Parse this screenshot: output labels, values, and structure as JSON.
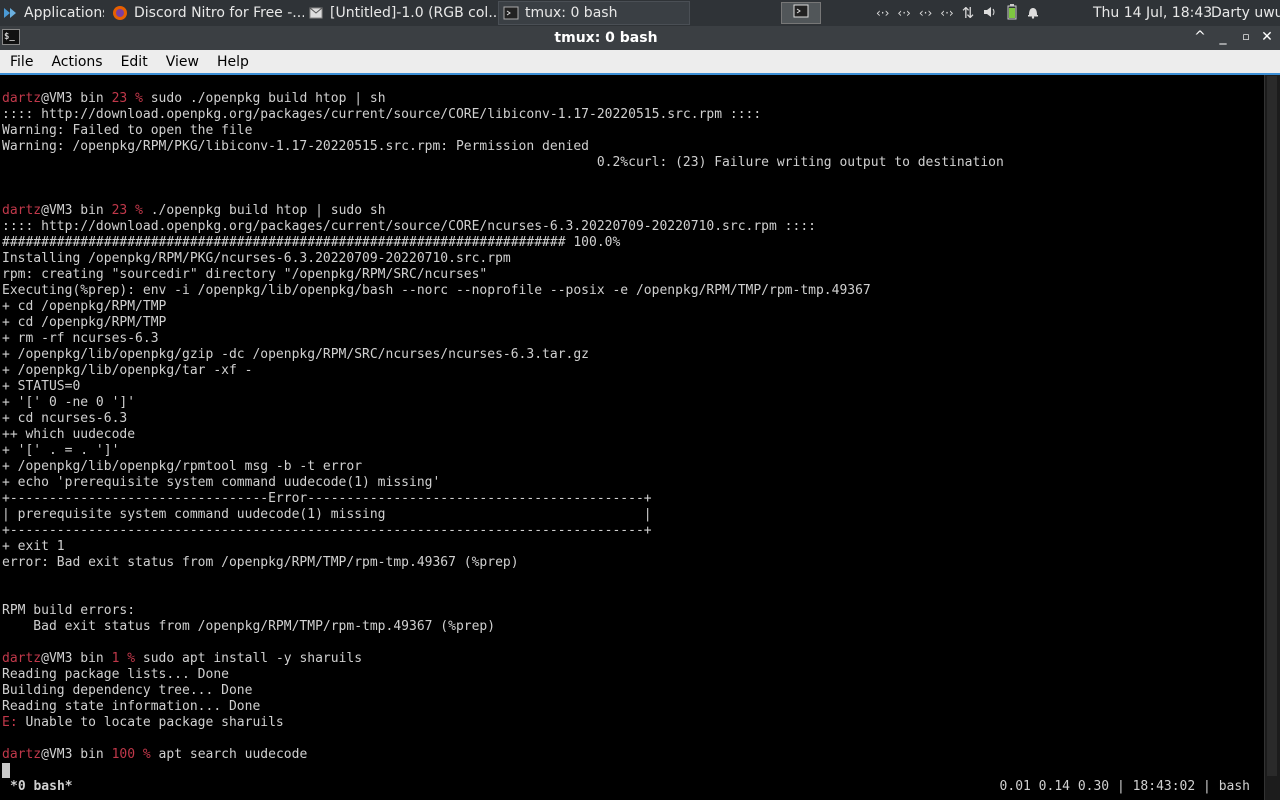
{
  "panel": {
    "applications": "Applications",
    "tasks": [
      {
        "label": "Discord Nitro for Free -...",
        "icon": "firefox-icon"
      },
      {
        "label": "[Untitled]-1.0 (RGB col...",
        "icon": "gimp-icon"
      },
      {
        "label": "tmux: 0 bash",
        "icon": "terminal-icon"
      }
    ],
    "tray_icons": [
      "network-icon",
      "network-icon",
      "network-icon",
      "network-icon",
      "transfer-icon",
      "volume-icon",
      "battery-icon",
      "bell-icon"
    ],
    "tray_glyphs": [
      "‹·›",
      "‹·›",
      "‹·›",
      "‹·›",
      "⇅",
      "🔊",
      "▮",
      "🔔"
    ],
    "clock": "Thu 14 Jul, 18:43",
    "user": "Darty uwu"
  },
  "window": {
    "title": "tmux: 0 bash",
    "menu": [
      "File",
      "Actions",
      "Edit",
      "View",
      "Help"
    ]
  },
  "prompt": {
    "user": "dartz",
    "host_dir": "@VM3 bin "
  },
  "terminal": [
    {
      "type": "prompt",
      "code": "23",
      "cmd": " sudo ./openpkg build htop | sh"
    },
    {
      "type": "text",
      "text": ":::: http://download.openpkg.org/packages/current/source/CORE/libiconv-1.17-20220515.src.rpm ::::"
    },
    {
      "type": "text",
      "text": "Warning: Failed to open the file"
    },
    {
      "type": "text",
      "text": "Warning: /openpkg/RPM/PKG/libiconv-1.17-20220515.src.rpm: Permission denied"
    },
    {
      "type": "text",
      "text": "                                                                            0.2%curl: (23) Failure writing output to destination"
    },
    {
      "type": "blank"
    },
    {
      "type": "blank"
    },
    {
      "type": "prompt",
      "code": "23",
      "cmd": " ./openpkg build htop | sudo sh"
    },
    {
      "type": "text",
      "text": ":::: http://download.openpkg.org/packages/current/source/CORE/ncurses-6.3.20220709-20220710.src.rpm ::::"
    },
    {
      "type": "text",
      "text": "######################################################################## 100.0%"
    },
    {
      "type": "text",
      "text": "Installing /openpkg/RPM/PKG/ncurses-6.3.20220709-20220710.src.rpm"
    },
    {
      "type": "text",
      "text": "rpm: creating \"sourcedir\" directory \"/openpkg/RPM/SRC/ncurses\""
    },
    {
      "type": "text",
      "text": "Executing(%prep): env -i /openpkg/lib/openpkg/bash --norc --noprofile --posix -e /openpkg/RPM/TMP/rpm-tmp.49367"
    },
    {
      "type": "text",
      "text": "+ cd /openpkg/RPM/TMP"
    },
    {
      "type": "text",
      "text": "+ cd /openpkg/RPM/TMP"
    },
    {
      "type": "text",
      "text": "+ rm -rf ncurses-6.3"
    },
    {
      "type": "text",
      "text": "+ /openpkg/lib/openpkg/gzip -dc /openpkg/RPM/SRC/ncurses/ncurses-6.3.tar.gz"
    },
    {
      "type": "text",
      "text": "+ /openpkg/lib/openpkg/tar -xf -"
    },
    {
      "type": "text",
      "text": "+ STATUS=0"
    },
    {
      "type": "text",
      "text": "+ '[' 0 -ne 0 ']'"
    },
    {
      "type": "text",
      "text": "+ cd ncurses-6.3"
    },
    {
      "type": "text",
      "text": "++ which uudecode"
    },
    {
      "type": "text",
      "text": "+ '[' . = . ']'"
    },
    {
      "type": "text",
      "text": "+ /openpkg/lib/openpkg/rpmtool msg -b -t error"
    },
    {
      "type": "text",
      "text": "+ echo 'prerequisite system command uudecode(1) missing'"
    },
    {
      "type": "text",
      "text": "+---------------------------------Error-------------------------------------------+"
    },
    {
      "type": "text",
      "text": "| prerequisite system command uudecode(1) missing                                 |"
    },
    {
      "type": "text",
      "text": "+---------------------------------------------------------------------------------+"
    },
    {
      "type": "text",
      "text": "+ exit 1"
    },
    {
      "type": "text",
      "text": "error: Bad exit status from /openpkg/RPM/TMP/rpm-tmp.49367 (%prep)"
    },
    {
      "type": "blank"
    },
    {
      "type": "blank"
    },
    {
      "type": "text",
      "text": "RPM build errors:"
    },
    {
      "type": "text",
      "text": "    Bad exit status from /openpkg/RPM/TMP/rpm-tmp.49367 (%prep)"
    },
    {
      "type": "blank"
    },
    {
      "type": "prompt",
      "code": "1",
      "cmd": " sudo apt install -y sharuils"
    },
    {
      "type": "text",
      "text": "Reading package lists... Done"
    },
    {
      "type": "text",
      "text": "Building dependency tree... Done"
    },
    {
      "type": "text",
      "text": "Reading state information... Done"
    },
    {
      "type": "error",
      "prefix": "E:",
      "text": " Unable to locate package sharuils"
    },
    {
      "type": "blank"
    },
    {
      "type": "prompt",
      "code": "100",
      "cmd": " apt search uudecode"
    }
  ],
  "status": {
    "left": "*0 bash*",
    "right": "0.01 0.14 0.30 | 18:43:02 | bash"
  },
  "colors": {
    "prompt_user": "#c0384a",
    "exit_code": "#c0384a",
    "accent": "#3c8fd6"
  }
}
